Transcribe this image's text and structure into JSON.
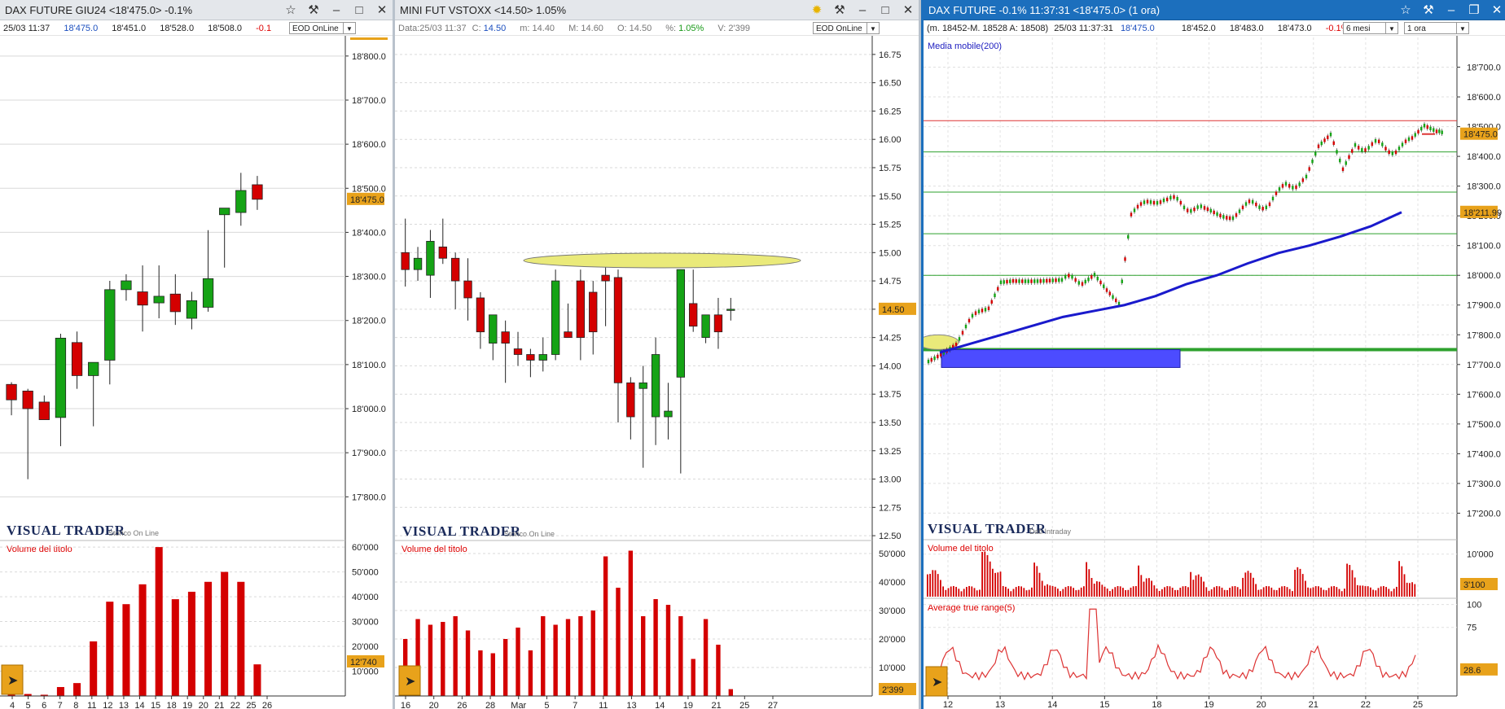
{
  "panels": [
    {
      "title": "DAX FUTURE GIU24 <18'475.0> -0.1%",
      "info": [
        "25/03 11:37",
        "18'475.0",
        "18'451.0",
        "18'528.0",
        "18'508.0",
        "-0.1"
      ],
      "selector": "EOD OnLine",
      "brand": "VISUAL TRADER",
      "brand_sub": "Storico On Line",
      "volume_title": "Volume del titolo",
      "price_marker": "18'475.0",
      "volume_marker": "12'740"
    },
    {
      "title": "MINI FUT VSTOXX <14.50> 1.05%",
      "info": {
        "data": "Data:25/03 11:37",
        "c_label": "C:",
        "c": "14.50",
        "m": "m: 14.40",
        "M": "M: 14.60",
        "o": "O: 14.50",
        "pct_label": "%:",
        "pct": "1.05%",
        "v": "V: 2'399"
      },
      "selector": "EOD OnLine",
      "brand": "VISUAL TRADER",
      "brand_sub": "Storico On Line",
      "volume_title": "Volume del titolo",
      "price_marker": "14.50",
      "volume_marker": "2'399"
    },
    {
      "title": "DAX FUTURE -0.1% 11:37:31  <18'475.0> (1 ora)",
      "info": {
        "range": "(m. 18452-M. 18528 A: 18508)",
        "time": "25/03 11:37:31",
        "last": "18'475.0",
        "v1": "18'452.0",
        "v2": "18'483.0",
        "v3": "18'473.0",
        "pct": "-0.1%"
      },
      "period_selector": "6 mesi",
      "interval_selector": "1 ora",
      "ma_title": "Media mobile(200)",
      "brand": "VISUAL TRADER",
      "brand_sub": "Dati Intraday",
      "volume_title": "Volume del titolo",
      "atr_title": "Average true range(5)",
      "price_marker": "18'475.0",
      "ma_marker": "18'211.99",
      "volume_marker": "3'100",
      "atr_marker": "28.6"
    }
  ],
  "icons": [
    "star-icon",
    "hammer-icon",
    "minimize-icon",
    "maximize-icon",
    "close-icon",
    "play-arrow-icon",
    "sun-icon"
  ],
  "chart_data": [
    {
      "type": "candlestick",
      "title": "DAX FUTURE GIU24",
      "x": [
        "4",
        "5",
        "6",
        "7",
        "8",
        "11",
        "12",
        "13",
        "14",
        "15",
        "18",
        "19",
        "20",
        "21",
        "22",
        "25",
        "26"
      ],
      "ohlc": [
        [
          18055,
          18060,
          17985,
          18020
        ],
        [
          18040,
          18045,
          17840,
          18000
        ],
        [
          18015,
          18030,
          17980,
          17975
        ],
        [
          17980,
          18170,
          17915,
          18160
        ],
        [
          18150,
          18175,
          18045,
          18075
        ],
        [
          18075,
          18105,
          17960,
          18105
        ],
        [
          18110,
          18290,
          18055,
          18270
        ],
        [
          18270,
          18305,
          18245,
          18290
        ],
        [
          18265,
          18325,
          18175,
          18235
        ],
        [
          18240,
          18325,
          18205,
          18255
        ],
        [
          18260,
          18305,
          18190,
          18220
        ],
        [
          18205,
          18265,
          18180,
          18245
        ],
        [
          18230,
          18405,
          18220,
          18295
        ],
        [
          18440,
          18440,
          18320,
          18455
        ],
        [
          18445,
          18535,
          18415,
          18495
        ],
        [
          18508,
          18528,
          18451,
          18475
        ]
      ],
      "ylim": [
        17760,
        18820
      ],
      "yticks": [
        "17'800.0",
        "17'900.0",
        "18'000.0",
        "18'100.0",
        "18'200.0",
        "18'300.0",
        "18'400.0",
        "18'500.0",
        "18'600.0",
        "18'700.0",
        "18'800.0"
      ],
      "volume": {
        "values": [
          1000,
          800,
          500,
          3600,
          5200,
          22000,
          38000,
          37000,
          45000,
          60000,
          39000,
          42000,
          46000,
          50000,
          46000,
          12740
        ],
        "yticks": [
          "10'000",
          "20'000",
          "30'000",
          "40'000",
          "50'000",
          "60'000"
        ],
        "ylim": [
          0,
          62000
        ]
      }
    },
    {
      "type": "candlestick",
      "title": "MINI FUT VSTOXX",
      "x": [
        "16",
        "20",
        "26",
        "28",
        "Mar",
        "5",
        "7",
        "11",
        "13",
        "14",
        "19",
        "21",
        "25",
        "27"
      ],
      "ohlc": [
        [
          15.0,
          15.3,
          14.7,
          14.85
        ],
        [
          14.85,
          15.05,
          14.75,
          14.95
        ],
        [
          14.8,
          15.2,
          14.6,
          15.1
        ],
        [
          15.05,
          15.3,
          14.9,
          14.95
        ],
        [
          14.95,
          15.0,
          14.5,
          14.75
        ],
        [
          14.75,
          14.95,
          14.4,
          14.6
        ],
        [
          14.6,
          14.65,
          14.15,
          14.3
        ],
        [
          14.2,
          14.45,
          14.05,
          14.45
        ],
        [
          14.3,
          14.4,
          13.85,
          14.2
        ],
        [
          14.15,
          14.3,
          14.0,
          14.1
        ],
        [
          14.1,
          14.15,
          13.9,
          14.05
        ],
        [
          14.05,
          14.25,
          13.95,
          14.1
        ],
        [
          14.1,
          14.85,
          14.05,
          14.75
        ],
        [
          14.3,
          14.55,
          14.25,
          14.25
        ],
        [
          14.75,
          14.85,
          14.05,
          14.25
        ],
        [
          14.65,
          14.75,
          14.1,
          14.3
        ],
        [
          14.8,
          14.95,
          14.35,
          14.75
        ],
        [
          14.78,
          14.85,
          13.5,
          13.85
        ],
        [
          13.85,
          13.9,
          13.35,
          13.55
        ],
        [
          13.8,
          14.0,
          13.1,
          13.85
        ],
        [
          13.55,
          14.25,
          13.3,
          14.1
        ],
        [
          13.55,
          13.85,
          13.35,
          13.6
        ],
        [
          13.9,
          14.85,
          13.05,
          14.85
        ],
        [
          14.55,
          14.85,
          14.3,
          14.35
        ],
        [
          14.25,
          14.45,
          14.2,
          14.45
        ],
        [
          14.45,
          14.6,
          14.15,
          14.3
        ],
        [
          14.5,
          14.6,
          14.4,
          14.5
        ]
      ],
      "ylim": [
        12.4,
        16.9
      ],
      "yticks": [
        "12.50",
        "12.75",
        "13.00",
        "13.25",
        "13.50",
        "13.75",
        "14.00",
        "14.25",
        "14.50",
        "14.75",
        "15.00",
        "15.25",
        "15.50",
        "15.75",
        "16.00",
        "16.25",
        "16.50",
        "16.75"
      ],
      "volume": {
        "values": [
          20000,
          27000,
          25000,
          26000,
          28000,
          23000,
          16000,
          15000,
          20000,
          24000,
          16000,
          28000,
          25000,
          27000,
          28000,
          30000,
          49000,
          38000,
          51000,
          28000,
          34000,
          32000,
          28000,
          13000,
          27000,
          18000,
          2399
        ],
        "yticks": [
          "10'000",
          "20'000",
          "30'000",
          "40'000",
          "50'000"
        ],
        "ylim": [
          0,
          54000
        ]
      }
    },
    {
      "type": "candlestick",
      "title": "DAX FUTURE (1 ora)",
      "x": [
        "12",
        "13",
        "14",
        "15",
        "18",
        "19",
        "20",
        "21",
        "22",
        "25"
      ],
      "ylim": [
        17130,
        18800
      ],
      "yticks": [
        "17'200.0",
        "17'300.0",
        "17'400.0",
        "17'500.0",
        "17'600.0",
        "17'700.0",
        "17'800.0",
        "17'900.0",
        "18'000.0",
        "18'100.0",
        "18'200.0",
        "18'300.0",
        "18'400.0",
        "18'500.0",
        "18'600.0",
        "18'700.0"
      ],
      "series": [
        {
          "name": "Media mobile(200)",
          "values": [
            17740,
            17770,
            17800,
            17830,
            17860,
            17880,
            17900,
            17930,
            17970,
            18000,
            18040,
            18075,
            18100,
            18130,
            18165,
            18211.99
          ]
        }
      ],
      "levels": [
        18520,
        18415,
        18280,
        18140,
        18000,
        17750
      ],
      "volume": {
        "ylim": [
          0,
          13000
        ],
        "yticks": [
          "10'000"
        ]
      },
      "atr": {
        "ylim": [
          0,
          105
        ],
        "yticks": [
          "75",
          "100"
        ],
        "last": 28.6
      }
    }
  ]
}
